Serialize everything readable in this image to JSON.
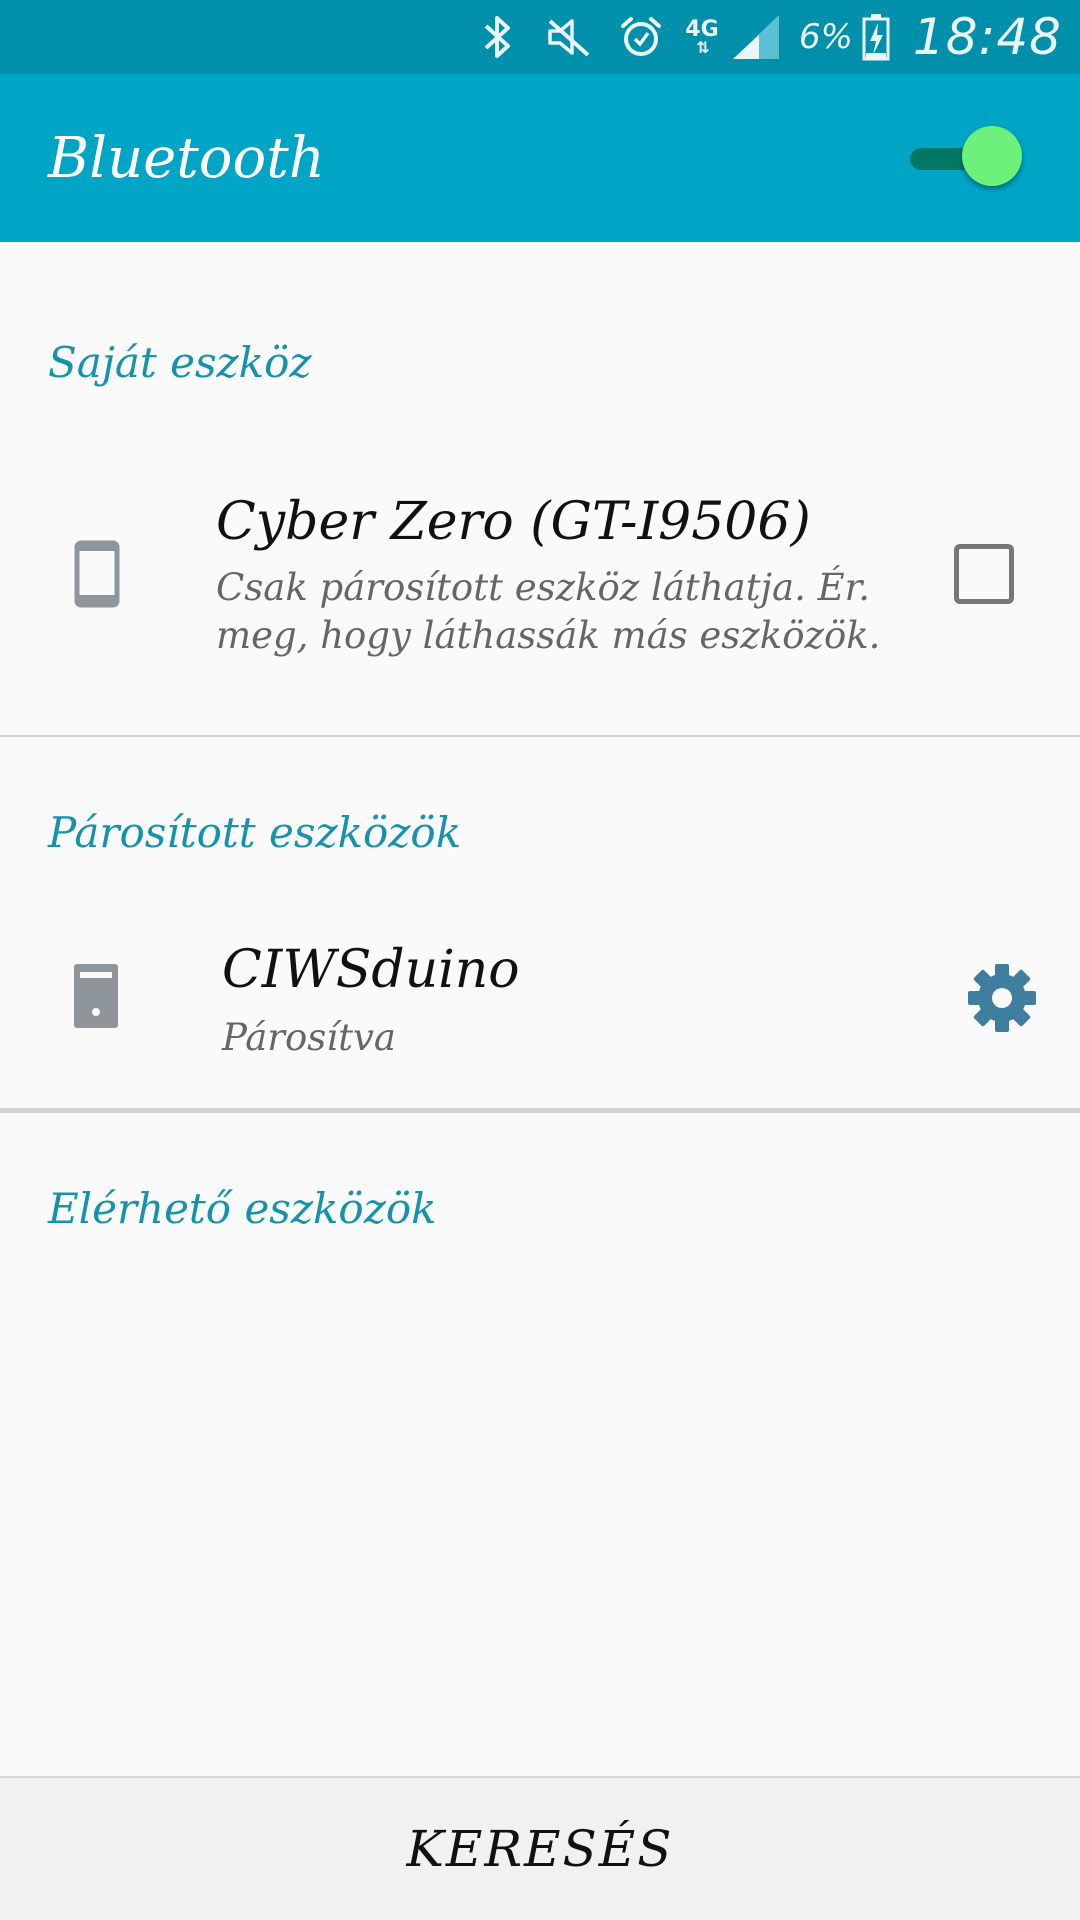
{
  "status_bar": {
    "network": "4G",
    "network_arrows": "⇅",
    "battery_percent": "6%",
    "time": "18:48",
    "icons": [
      "bluetooth-icon",
      "muted-icon",
      "alarm-icon",
      "signal-icon",
      "battery-charging-icon"
    ]
  },
  "app_bar": {
    "title": "Bluetooth",
    "toggle_on": true,
    "toggle_color": "#6cf27a"
  },
  "own_device": {
    "header": "Saját eszköz",
    "name": "Cyber Zero (GT-I9506)",
    "description": "Csak párosított eszköz láthatja. Ér. meg, hogy láthassák más eszközök.",
    "icon": "phone-icon",
    "visible_checked": false
  },
  "paired_devices": {
    "header": "Párosított eszközök",
    "items": [
      {
        "name": "CIWSduino",
        "status": "Párosítva",
        "icon": "device-icon",
        "settings_icon": "gear-icon"
      }
    ]
  },
  "available_devices": {
    "header": "Elérhető eszközök",
    "items": []
  },
  "bottom": {
    "search_label": "KERESÉS"
  },
  "colors": {
    "status_bar": "#0090ab",
    "app_bar": "#00a4c4",
    "section_header": "#1593ad",
    "gear": "#3f7e9f"
  }
}
